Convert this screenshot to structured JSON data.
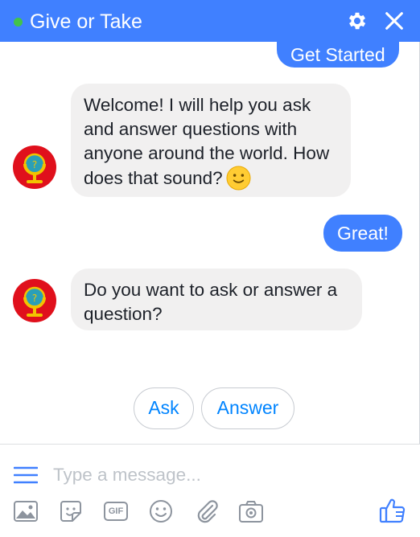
{
  "header": {
    "title": "Give or Take",
    "accent_color": "#4080ff",
    "status_color": "#42c34a"
  },
  "messages": [
    {
      "from": "user",
      "text": "Get Started"
    },
    {
      "from": "bot",
      "text": "Welcome! I will help you ask and answer questions with anyone around the world. How does that sound?",
      "emoji": "slightly-smiling-face"
    },
    {
      "from": "user",
      "text": "Great!"
    },
    {
      "from": "bot",
      "text": "Do you want to ask or answer a question?"
    }
  ],
  "quick_replies": [
    "Ask",
    "Answer"
  ],
  "composer": {
    "placeholder": "Type a message...",
    "tools": [
      "image-icon",
      "sticker-icon",
      "gif-icon",
      "emoji-icon",
      "attachment-icon",
      "camera-icon",
      "thumbs-up-icon"
    ],
    "gif_label": "GIF"
  }
}
